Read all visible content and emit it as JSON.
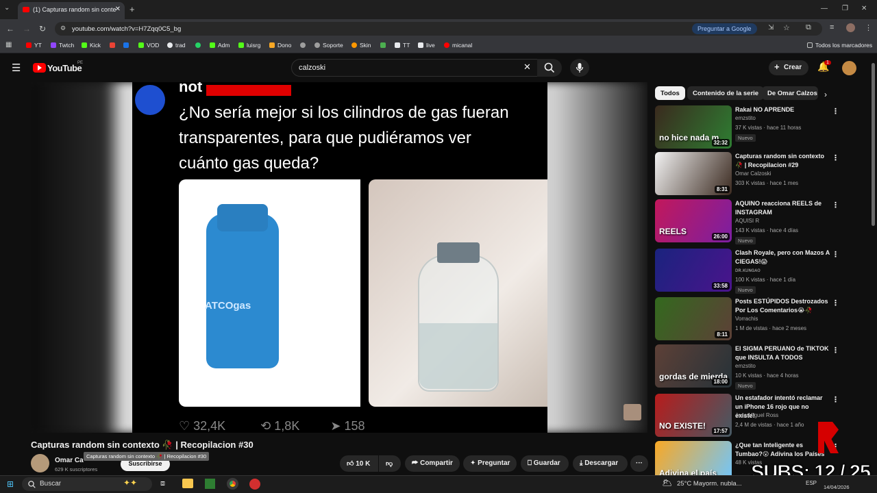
{
  "browser": {
    "tab_title": "(1) Capturas random sin conte",
    "url": "youtube.com/watch?v=H7Zqq0C5_bg",
    "ask_google": "Preguntar a Google",
    "bookmarks": [
      "YT",
      "Twtch",
      "Kick",
      "VOD",
      "trad",
      "Adm",
      "luisrg",
      "Dono",
      "Soporte",
      "Skin",
      "TT",
      "live",
      "micanal"
    ],
    "all_bookmarks": "Todos los marcadores"
  },
  "youtube": {
    "logo": "YouTube",
    "region": "PE",
    "search_value": "calzoski",
    "create_label": "Crear",
    "notif_count": "1"
  },
  "video": {
    "overlay_user": "not",
    "overlay_text": [
      "¿No sería mejor si los cilindros de gas fueran",
      "transparentes, para que pudiéramos ver",
      "cuánto gas queda?"
    ],
    "cylinder_brand": "ATCOgas",
    "stats": [
      "32,4K",
      "1,8K",
      "158"
    ]
  },
  "info": {
    "title": "Capturas random sin contexto 🥀 | Recopilacion #30",
    "tooltip": "Capturas random sin contexto 🥀 | Recopilacion #30",
    "channel": "Omar Ca",
    "subs": "629 K suscriptores",
    "subscribe": "Suscribirse",
    "likes": "10 K",
    "share": "Compartir",
    "ask": "Preguntar",
    "save": "Guardar",
    "download": "Descargar"
  },
  "chips": [
    "Todos",
    "Contenido de la serie",
    "De Omar Calzos"
  ],
  "recommendations": [
    {
      "title": "Rakai NO APRENDE",
      "channel": "emzstito",
      "meta": "37 K vistas · hace 11 horas",
      "badge": "Nuevo",
      "duration": "32:32",
      "thumb_text": "no hice nada m",
      "c1": "#3a2a1e",
      "c2": "#2e7d32"
    },
    {
      "title": "Capturas random sin contexto 🥀 | Recopilacion #29",
      "channel": "Omar Calzoski",
      "meta": "303 K vistas · hace 1 mes",
      "badge": "",
      "duration": "8:31",
      "thumb_text": "",
      "c1": "#f2f2f2",
      "c2": "#3b2a20"
    },
    {
      "title": "AQUINO reacciona REELS de INSTAGRAM",
      "channel": "AQUISI R",
      "meta": "143 K vistas · hace 4 días",
      "badge": "Nuevo",
      "duration": "26:00",
      "thumb_text": "REELS",
      "c1": "#c2185b",
      "c2": "#7b1fa2"
    },
    {
      "title": "Clash Royale, pero con Mazos A CIEGAS!😱",
      "channel": "ᴅʀ.ᴋᴜɴɢᴀᴏ",
      "meta": "100 K vistas · hace 1 día",
      "badge": "Nuevo",
      "duration": "33:58",
      "thumb_text": "",
      "c1": "#1a237e",
      "c2": "#4a148c"
    },
    {
      "title": "Posts ESTÚPIDOS Destrozados Por Los Comentarios😭🥀",
      "channel": "Vorrachis",
      "meta": "1 M de vistas · hace 2 meses",
      "badge": "",
      "duration": "8:11",
      "thumb_text": "",
      "c1": "#33691e",
      "c2": "#5d4037"
    },
    {
      "title": "El SIGMA PERUANO de TIKTOK que INSULTA A TODOS",
      "channel": "emzstito",
      "meta": "10 K vistas · hace 4 horas",
      "badge": "Nuevo",
      "duration": "18:00",
      "thumb_text": "gordas de mierda",
      "c1": "#5d4037",
      "c2": "#263238"
    },
    {
      "title": "Un estafador intentó reclamar un iPhone 16 rojo que no existe!",
      "channel": "Jose Miguel Ross",
      "meta": "2,4 M de vistas · hace 1 año",
      "badge": "",
      "duration": "17:57",
      "thumb_text": "NO EXISTE!",
      "c1": "#b71c1c",
      "c2": "#455a64"
    },
    {
      "title": "¿Que tan Inteligente es Tumbao?😮 Adivina los Países",
      "channel": "",
      "meta": "48 K vistas",
      "badge": "",
      "duration": "",
      "thumb_text": "Adivina el país",
      "c1": "#f9a825",
      "c2": "#6ec6ff"
    }
  ],
  "overlay_subs": "SUBS: 12 / 25",
  "taskbar": {
    "search": "Buscar",
    "weather": "25°C  Mayorm. nubla...",
    "lang": "ESP",
    "date": "14/04/2026"
  },
  "colors": {
    "yt_red": "#ff0000",
    "bg": "#0f0f0f",
    "pill": "#272727"
  }
}
